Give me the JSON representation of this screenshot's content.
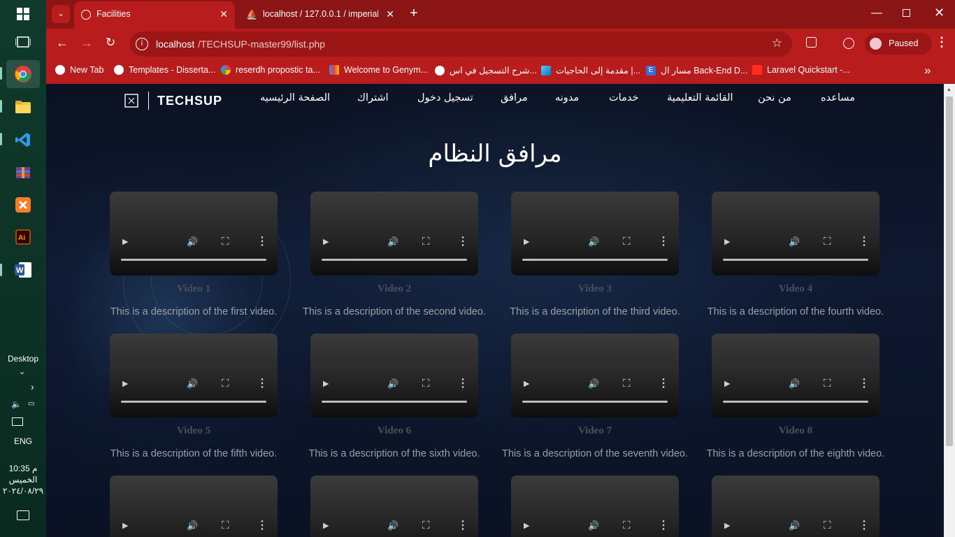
{
  "taskbar": {
    "desktop_label": "Desktop",
    "language": "ENG",
    "time": "10:35 م",
    "day": "الخميس",
    "date": "٢٠٢٤/٠٨/٢٩"
  },
  "tabs": [
    {
      "title": "Facilities"
    },
    {
      "title": "localhost / 127.0.0.1 / imperial_"
    }
  ],
  "toolbar": {
    "url_host": "localhost",
    "url_path": "/TECHSUP-master99/list.php",
    "profile_status": "Paused"
  },
  "bookmarks": [
    {
      "label": "New Tab",
      "icon": "globe-icon"
    },
    {
      "label": "Templates - Disserta...",
      "icon": "globe-icon"
    },
    {
      "label": "reserdh propostic ta...",
      "icon": "google-icon"
    },
    {
      "label": "Welcome to Genym...",
      "icon": "gmail-icon"
    },
    {
      "label": "شرح التسجيل في اس...",
      "icon": "globe-icon"
    },
    {
      "label": "مقدمة إلى الحاجيات |...",
      "icon": "flutter-icon"
    },
    {
      "label": "مسار ال Back-End D...",
      "icon": "e-icon"
    },
    {
      "label": "Laravel Quickstart -...",
      "icon": "laravel-icon"
    }
  ],
  "site": {
    "brand": "TECHSUP",
    "nav": [
      "مساعده",
      "من نحن",
      "القائمة التعليمية",
      "خدمات",
      "مدونه",
      "مرافق",
      "تسجيل دخول",
      "اشتراك",
      "الصفحة الرئيسيه"
    ],
    "page_title": "مرافق النظام",
    "videos": [
      {
        "name": "Video 1",
        "desc": "This is a description of the first video."
      },
      {
        "name": "Video 2",
        "desc": "This is a description of the second video."
      },
      {
        "name": "Video 3",
        "desc": "This is a description of the third video."
      },
      {
        "name": "Video 4",
        "desc": "This is a description of the fourth video."
      },
      {
        "name": "Video 5",
        "desc": "This is a description of the fifth video."
      },
      {
        "name": "Video 6",
        "desc": "This is a description of the sixth video."
      },
      {
        "name": "Video 7",
        "desc": "This is a description of the seventh video."
      },
      {
        "name": "Video 8",
        "desc": "This is a description of the eighth video."
      }
    ]
  },
  "colors": {
    "chrome_dark": "#8b1414",
    "chrome": "#b81c1c",
    "omnibox": "#9c1616",
    "taskbar": "#0d3326"
  }
}
